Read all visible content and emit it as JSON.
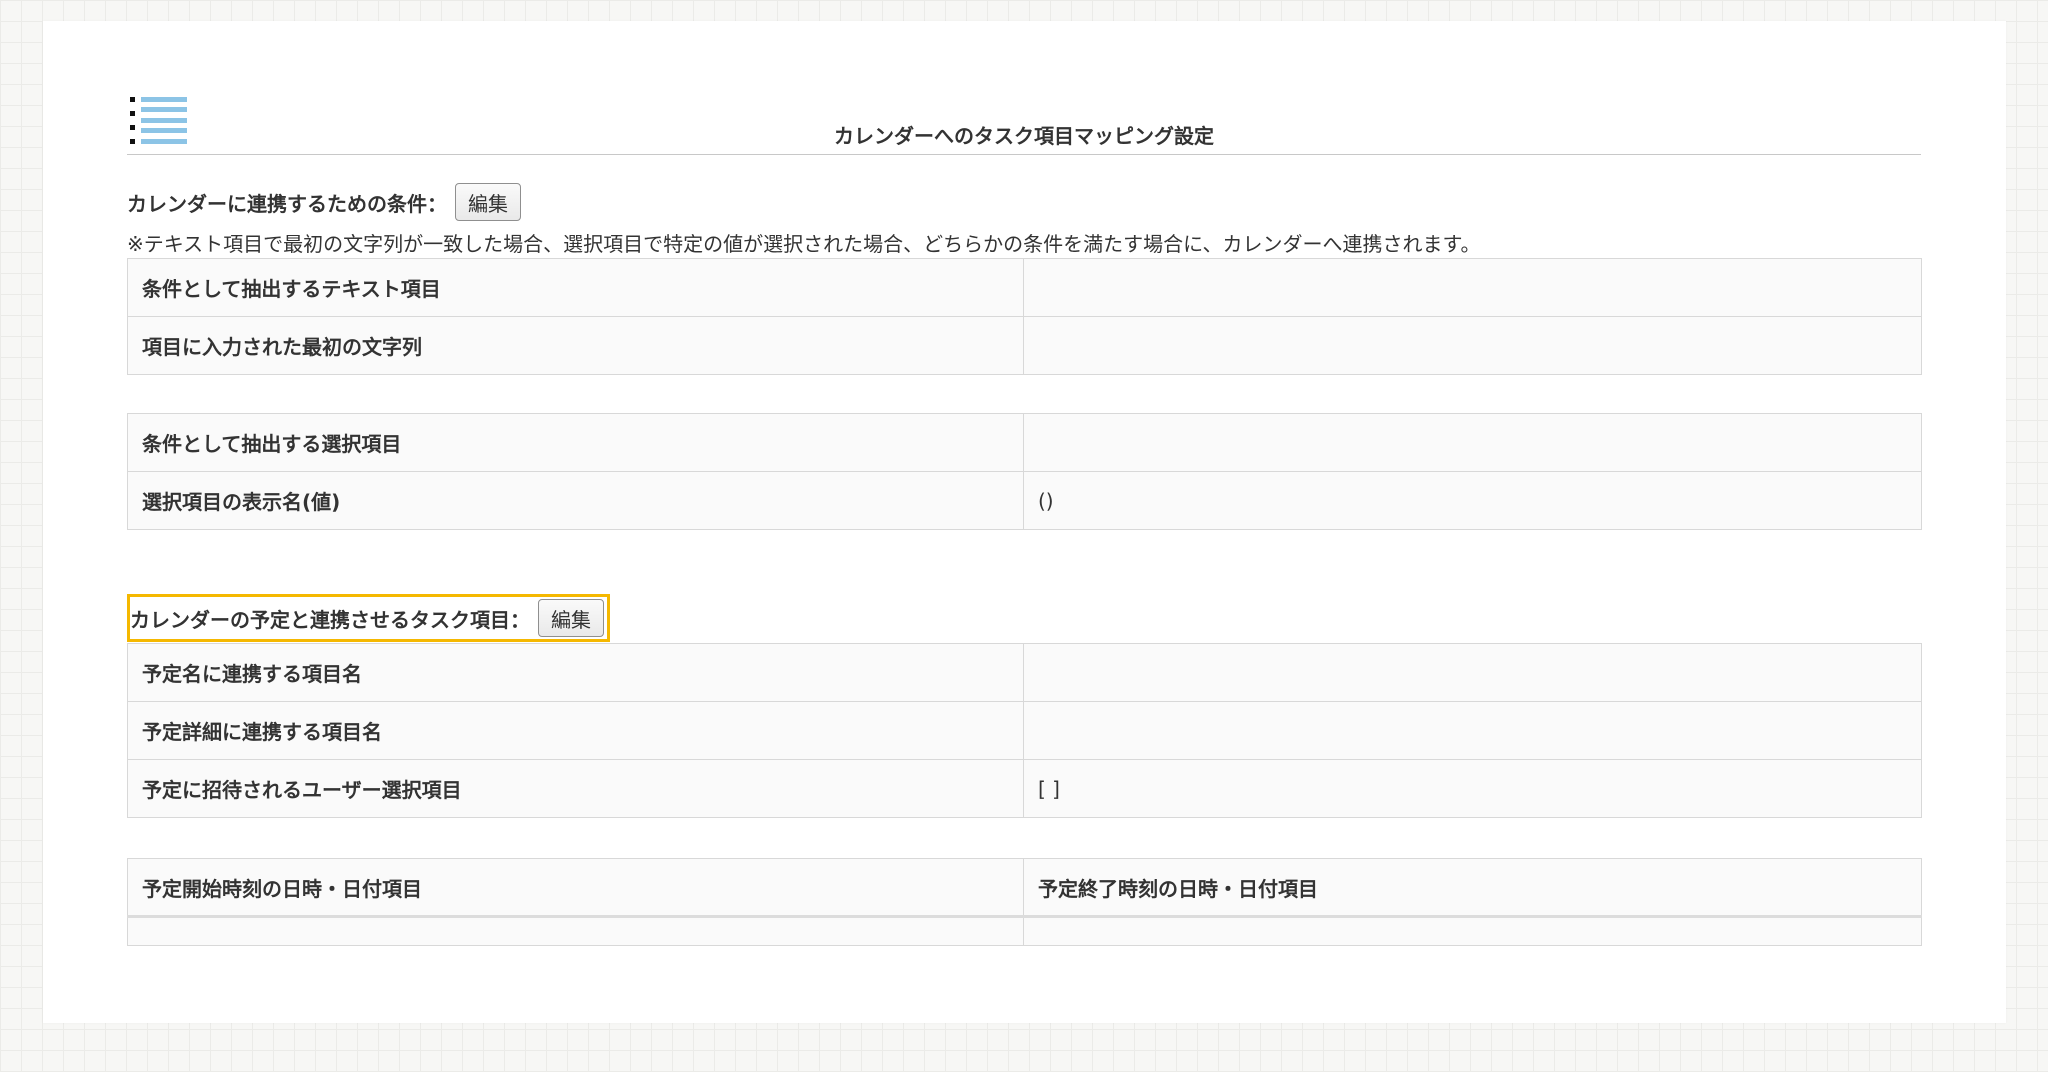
{
  "page_title": "カレンダーへのタスク項目マッピング設定",
  "conditions_section": {
    "heading": "カレンダーに連携するための条件：",
    "edit_label": "編集",
    "note": "※テキスト項目で最初の文字列が一致した場合、選択項目で特定の値が選択された場合、どちらかの条件を満たす場合に、カレンダーへ連携されます。",
    "text_table": [
      {
        "label": "条件として抽出するテキスト項目",
        "value": ""
      },
      {
        "label": "項目に入力された最初の文字列",
        "value": ""
      }
    ],
    "select_table": [
      {
        "label": "条件として抽出する選択項目",
        "value": ""
      },
      {
        "label": "選択項目の表示名(値)",
        "value": "()"
      }
    ]
  },
  "mapping_section": {
    "heading": "カレンダーの予定と連携させるタスク項目：",
    "edit_label": "編集",
    "items_table": [
      {
        "label": "予定名に連携する項目名",
        "value": ""
      },
      {
        "label": "予定詳細に連携する項目名",
        "value": ""
      },
      {
        "label": "予定に招待されるユーザー選択項目",
        "value": "[ ]"
      }
    ],
    "datetime_table": {
      "headers": [
        "予定開始時刻の日時・日付項目",
        "予定終了時刻の日時・日付項目"
      ],
      "values": [
        "",
        ""
      ]
    }
  },
  "icons": {
    "menu": "list-menu-icon"
  },
  "colors": {
    "highlight": "#f5b800",
    "icon_blue": "#8cc4e6",
    "border": "#d8d8d8",
    "cell_bg": "#fafafa"
  }
}
